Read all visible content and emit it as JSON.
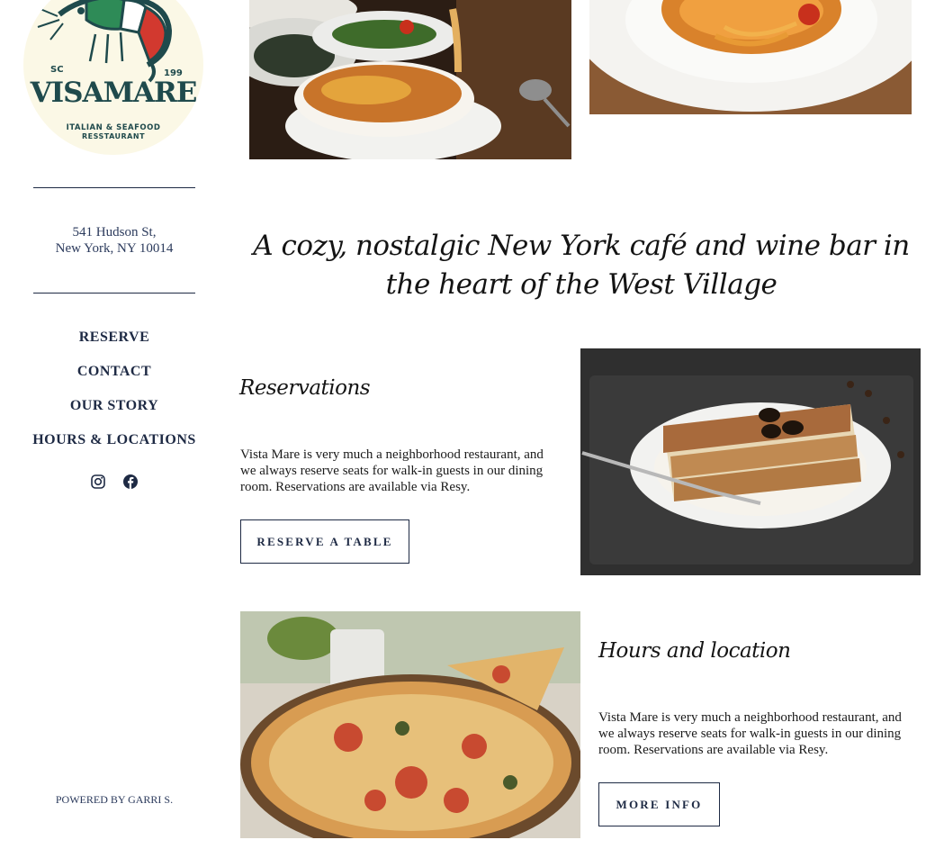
{
  "logo": {
    "brand": "VISAMARE",
    "left_mark": "SC",
    "right_mark": "199",
    "subtitle": "ITALIAN & SEAFOOD",
    "subtitle2": "RESSTAURANT"
  },
  "address": {
    "line1": "541 Hudson St,",
    "line2": "New York, NY 10014"
  },
  "nav": {
    "items": [
      {
        "label": "RESERVE"
      },
      {
        "label": "CONTACT"
      },
      {
        "label": "OUR STORY"
      },
      {
        "label": "HOURS & LOCATIONS"
      }
    ]
  },
  "socials": {
    "icons": [
      "instagram-icon",
      "facebook-icon"
    ]
  },
  "footer": {
    "powered_by": "POWERED BY GARRI S."
  },
  "tagline": "A cozy, nostalgic New York café and wine bar in the heart of the West Village",
  "reservations": {
    "title": "Reservations",
    "body": "Vista Mare is very much a neighborhood restaurant, and we always reserve seats for walk-in guests in our dining room. Reservations are available via Resy.",
    "button": "RESERVE A TABLE"
  },
  "hours": {
    "title": "Hours and location",
    "body": "Vista Mare is very much a neighborhood restaurant, and we always reserve seats for walk-in guests in our dining room. Reservations are available via Resy.",
    "button": "MORE INFO"
  },
  "colors": {
    "navy": "#1e2a44",
    "logo_cream": "#fbf8e6",
    "logo_teal": "#1f4a4c"
  }
}
